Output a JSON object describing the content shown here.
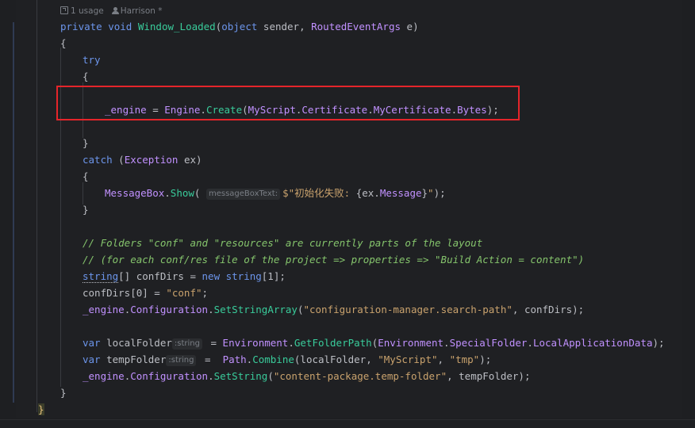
{
  "meta": {
    "usages": "1 usage",
    "author": "Harrison",
    "author_mark": "*"
  },
  "code": {
    "l01": {
      "kw1": "private",
      "kw2": "void",
      "name": "Window_Loaded",
      "p1": "(",
      "kw3": "object",
      "p2": " sender, ",
      "type1": "RoutedEventArgs",
      "p3": " e)"
    },
    "l02": "{",
    "l03": "try",
    "l04": "{",
    "l05": {
      "field": "_engine",
      "op": " = ",
      "type": "Engine",
      "dot1": ".",
      "method": "Create",
      "p1": "(",
      "a1": "MyScript",
      "d1": ".",
      "a2": "Certificate",
      "d2": ".",
      "a3": "MyCertificate",
      "d3": ".",
      "a4": "Bytes",
      "end": ");"
    },
    "l06": "}",
    "l07": {
      "kw": "catch",
      "p1": " (",
      "type": "Exception",
      "p2": " ex)"
    },
    "l08": "{",
    "l09": {
      "type": "MessageBox",
      "dot": ".",
      "method": "Show",
      "p1": "(",
      "hint": "messageBoxText:",
      "s1": "$\"初始化失败: ",
      "interp_open": "{",
      "v1": "ex",
      "d1": ".",
      "v2": "Message",
      "interp_close": "}",
      "s2": "\"",
      "end": ");"
    },
    "l10": "}",
    "l11": "// Folders \"conf\" and \"resources\" are currently parts of the layout",
    "l12": "// (for each conf/res file of the project => properties => \"Build Action = content\")",
    "l13": {
      "kw": "string",
      "p1": "[] confDirs = ",
      "kw2": "new",
      "sp": " ",
      "kw3": "string",
      "end": "[1];"
    },
    "l14": {
      "p1": "confDirs[0] = ",
      "str": "\"conf\"",
      "end": ";"
    },
    "l15": {
      "field": "_engine",
      "d1": ".",
      "prop": "Configuration",
      "d2": ".",
      "method": "SetStringArray",
      "p1": "(",
      "str": "\"configuration-manager.search-path\"",
      "end": ", confDirs);"
    },
    "l16": {
      "kw": "var",
      "name": " localFolder",
      "hint": ":string",
      "op": " = ",
      "type": "Environment",
      "d1": ".",
      "method": "GetFolderPath",
      "p1": "(",
      "type2": "Environment",
      "d2": ".",
      "enum": "SpecialFolder",
      "d3": ".",
      "member": "LocalApplicationData",
      "end": ");"
    },
    "l17": {
      "kw": "var",
      "name": " tempFolder",
      "hint": ":string",
      "op": " =  ",
      "type": "Path",
      "d1": ".",
      "method": "Combine",
      "p1": "(localFolder, ",
      "s1": "\"MyScript\"",
      "c": ", ",
      "s2": "\"tmp\"",
      "end": ");"
    },
    "l18": {
      "field": "_engine",
      "d1": ".",
      "prop": "Configuration",
      "d2": ".",
      "method": "SetString",
      "p1": "(",
      "str": "\"content-package.temp-folder\"",
      "end": ", tempFolder);"
    },
    "l19": "}",
    "l20": "}"
  },
  "colors": {
    "keyword": "#6c95eb",
    "method": "#39cc9b",
    "type": "#c191ff",
    "string": "#c9a26d",
    "comment": "#85c46c",
    "highlight_box": "#e5252a"
  }
}
